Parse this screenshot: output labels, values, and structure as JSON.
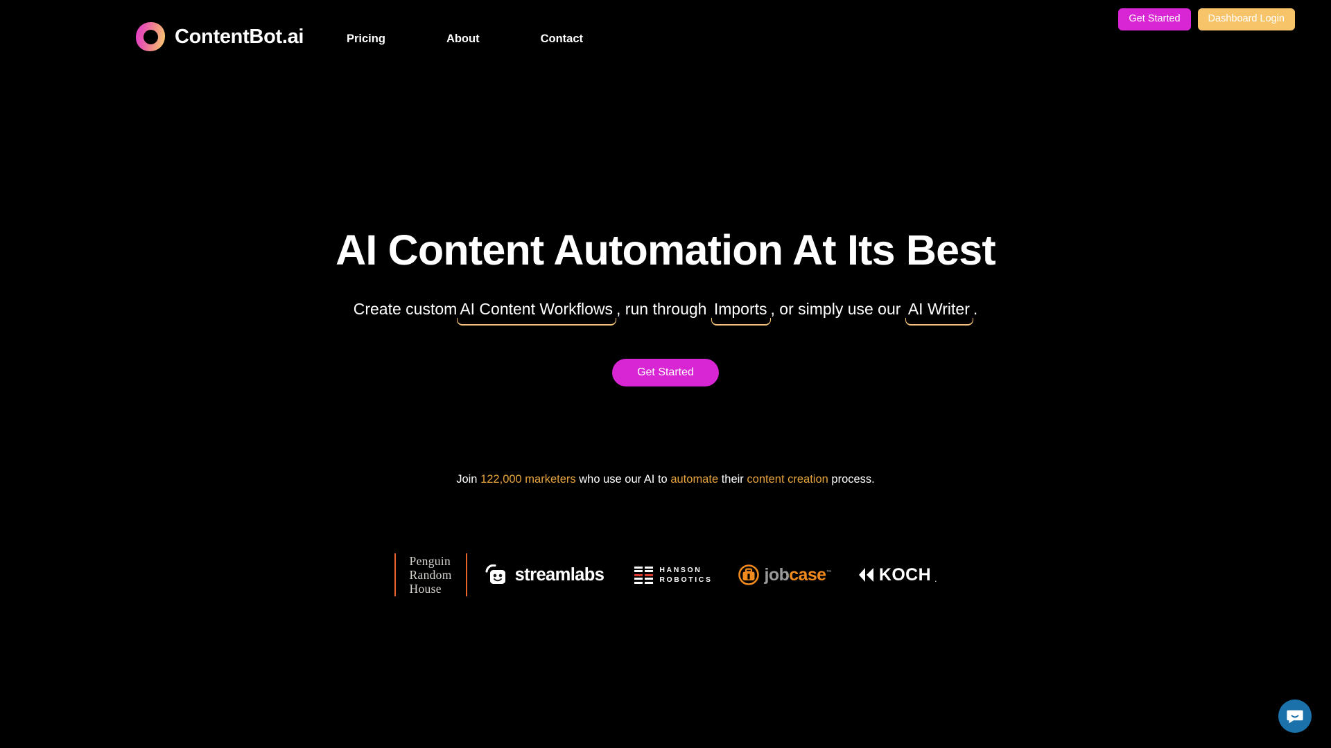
{
  "theme": {
    "background": "#000000",
    "magenta": "#d926d4",
    "amber": "#f8c46a",
    "underline": "#f6c37a",
    "highlight": "#e8a33d",
    "rule": "#e8642a",
    "chat_blue": "#1b72ab"
  },
  "header": {
    "brand_name": "ContentBot.ai",
    "logo_icon": "contentbot-ring-logo",
    "nav": [
      {
        "label": "Pricing"
      },
      {
        "label": "About"
      },
      {
        "label": "Contact"
      }
    ],
    "get_started_label": "Get Started",
    "dashboard_login_label": "Dashboard Login"
  },
  "hero": {
    "title": "AI Content Automation At Its Best",
    "subtitle": {
      "part1": "Create custom",
      "link1": "AI Content Workflows",
      "part2": ", run through",
      "link2": "Imports",
      "part3": ", or simply use our",
      "link3": "AI Writer",
      "part4": "."
    },
    "cta_label": "Get Started"
  },
  "social_proof": {
    "prefix": "Join ",
    "count": "122,000 marketers",
    "middle1": " who use our AI to ",
    "action": "automate",
    "middle2": " their ",
    "topic": "content creation",
    "suffix": " process."
  },
  "logos": [
    {
      "name": "penguin-random-house",
      "line1": "Penguin",
      "line2": "Random",
      "line3": "House"
    },
    {
      "name": "streamlabs",
      "label": "streamlabs"
    },
    {
      "name": "hanson-robotics",
      "line1": "HANSON",
      "line2": "ROBOTICS"
    },
    {
      "name": "jobcase",
      "part1": "job",
      "part2": "case",
      "tm": "™"
    },
    {
      "name": "koch",
      "label": "KOCH",
      "dot": "."
    }
  ],
  "chat": {
    "icon": "chat-bubble-icon",
    "label": "Open chat"
  }
}
